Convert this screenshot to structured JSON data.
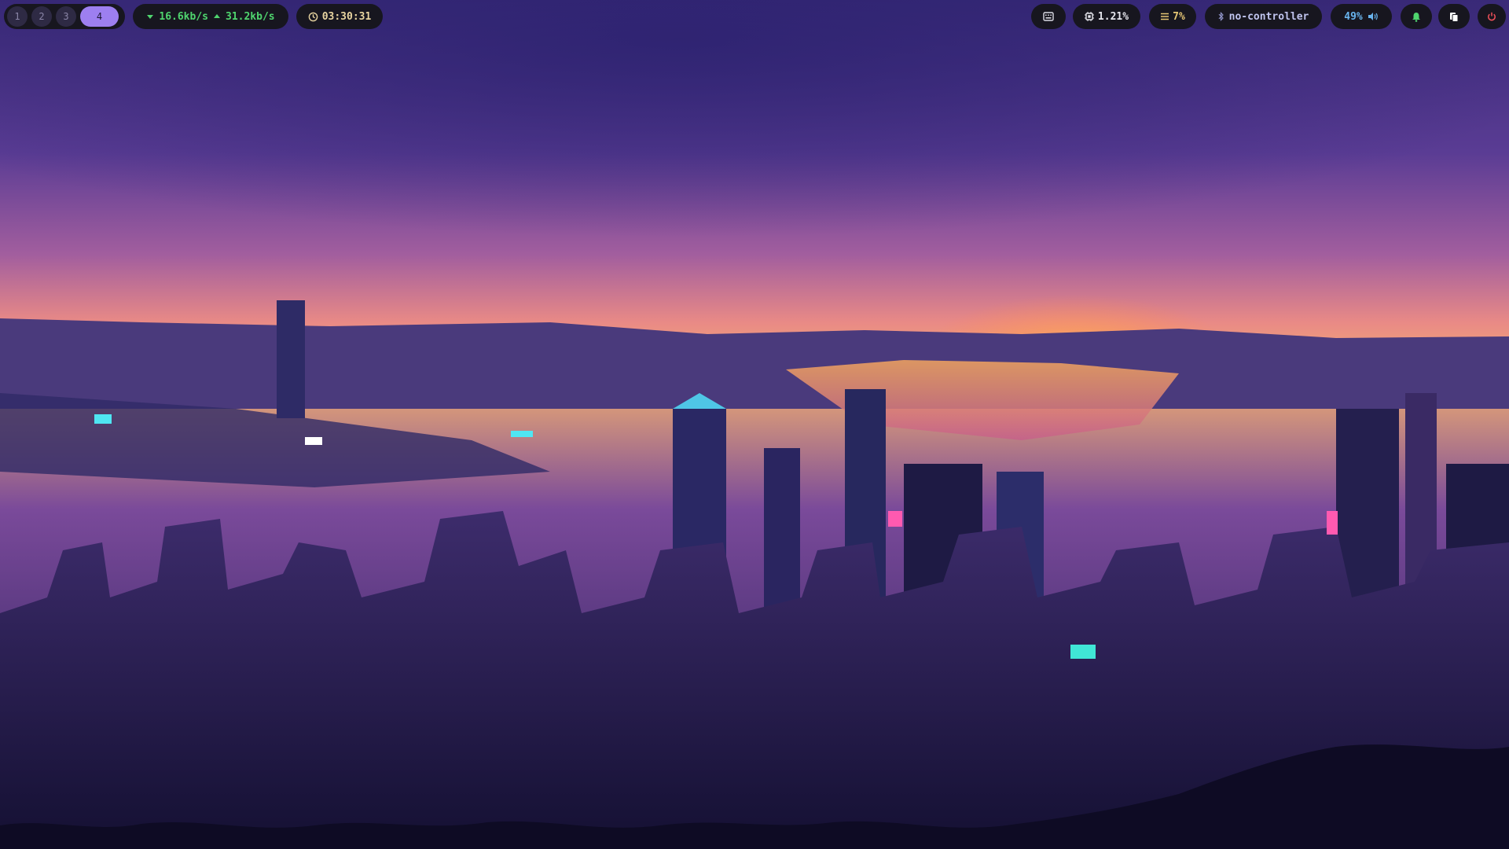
{
  "workspaces": [
    {
      "label": "1",
      "active": false
    },
    {
      "label": "2",
      "active": false
    },
    {
      "label": "3",
      "active": false
    },
    {
      "label": "4",
      "active": true
    }
  ],
  "network": {
    "down": "16.6kb/s",
    "up": "31.2kb/s",
    "down_icon": "arrow-down-icon",
    "up_icon": "arrow-up-icon"
  },
  "clock": {
    "time": "03:30:31",
    "icon": "clock-icon"
  },
  "keyboard": {
    "icon": "keyboard-icon"
  },
  "cpu": {
    "value": "1.21%",
    "icon": "cpu-icon"
  },
  "memory": {
    "value": "7%",
    "icon": "memory-icon"
  },
  "bluetooth": {
    "status": "no-controller",
    "icon": "bluetooth-icon"
  },
  "volume": {
    "value": "49%",
    "icon": "speaker-icon"
  },
  "notifications": {
    "icon": "bell-icon"
  },
  "clipboard": {
    "icon": "clipboard-icon"
  },
  "power": {
    "icon": "power-icon"
  },
  "colors": {
    "bar_bg": "#17161f",
    "workspace_active": "#9d7ff0",
    "network_green": "#4fd56e",
    "clock_text": "#e8d4a0",
    "memory_text": "#e6c674",
    "volume_text": "#69b4ee",
    "power_red": "#f0505a"
  },
  "wallpaper": {
    "subject": "neon-city-skyline-at-sunset"
  }
}
